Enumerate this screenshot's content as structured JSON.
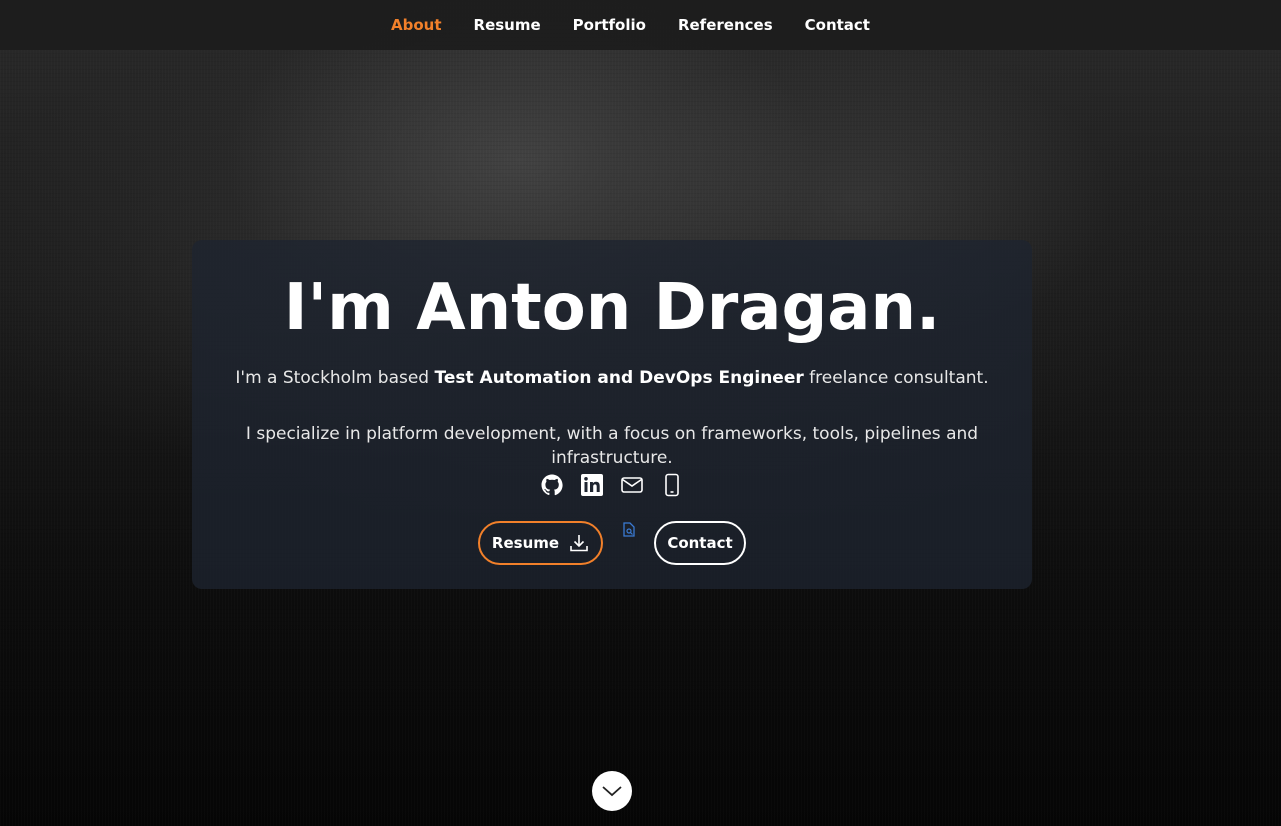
{
  "nav": {
    "items": [
      {
        "label": "About",
        "active": true
      },
      {
        "label": "Resume",
        "active": false
      },
      {
        "label": "Portfolio",
        "active": false
      },
      {
        "label": "References",
        "active": false
      },
      {
        "label": "Contact",
        "active": false
      }
    ]
  },
  "hero": {
    "title": "I'm Anton Dragan.",
    "intro_prefix": "I'm a Stockholm based ",
    "intro_bold": "Test Automation and DevOps Engineer",
    "intro_suffix": " freelance consultant.",
    "specialty": "I specialize in platform development, with a focus on frameworks, tools, pipelines and infrastructure."
  },
  "social": {
    "icons": [
      "github-icon",
      "linkedin-icon",
      "mail-icon",
      "phone-icon"
    ]
  },
  "buttons": {
    "resume_label": "Resume",
    "contact_label": "Contact"
  },
  "colors": {
    "accent": "#f2802a",
    "nav_bg": "#1c1c1c",
    "card_bg": "#1e2430",
    "text": "#ffffff"
  }
}
